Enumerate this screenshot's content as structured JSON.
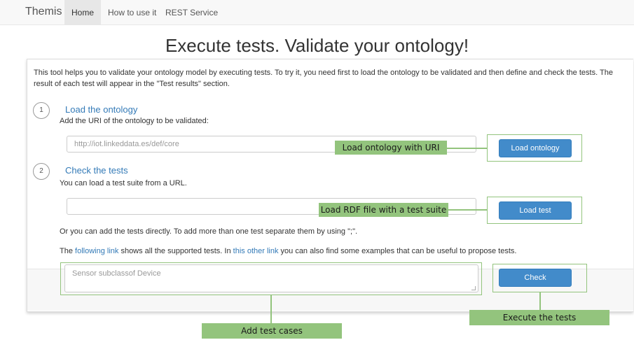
{
  "navbar": {
    "brand": "Themis",
    "items": [
      {
        "label": "Home",
        "active": true
      },
      {
        "label": "How to use it",
        "active": false
      },
      {
        "label": "REST Service",
        "active": false
      }
    ]
  },
  "page": {
    "title": "Execute tests. Validate your ontology!",
    "intro": "This tool helps you to validate your ontology model by executing tests. To try it, you need first to load the ontology to be validated and then define and check the tests. The result of each test will appear in the \"Test results\" section."
  },
  "step1": {
    "number": "1",
    "title": "Load the ontology",
    "description": "Add the URI of the ontology to be validated:",
    "input_placeholder": "http://iot.linkeddata.es/def/core",
    "button_label": "Load ontology"
  },
  "step2": {
    "number": "2",
    "title": "Check the tests",
    "description": "You can load a test suite from a URL.",
    "input_placeholder": "",
    "button_label": "Load test",
    "direct_text": "Or you can add the tests directly. To add more than one test separate them by using \";\".",
    "links_text_pre": "The ",
    "link1": "following link",
    "links_text_mid": " shows all the supported tests. In ",
    "link2": "this other link",
    "links_text_post": " you can also find some examples that can be useful to propose tests.",
    "textarea_placeholder": "Sensor subclassof Device",
    "check_label": "Check"
  },
  "annotations": {
    "load_ontology": "Load ontology with URI",
    "load_rdf": "Load RDF file with a test suite",
    "add_cases": "Add test cases",
    "execute": "Execute the tests"
  },
  "colors": {
    "primary_button": "#428bca",
    "link": "#337ab7",
    "annotation": "#93c47d"
  }
}
